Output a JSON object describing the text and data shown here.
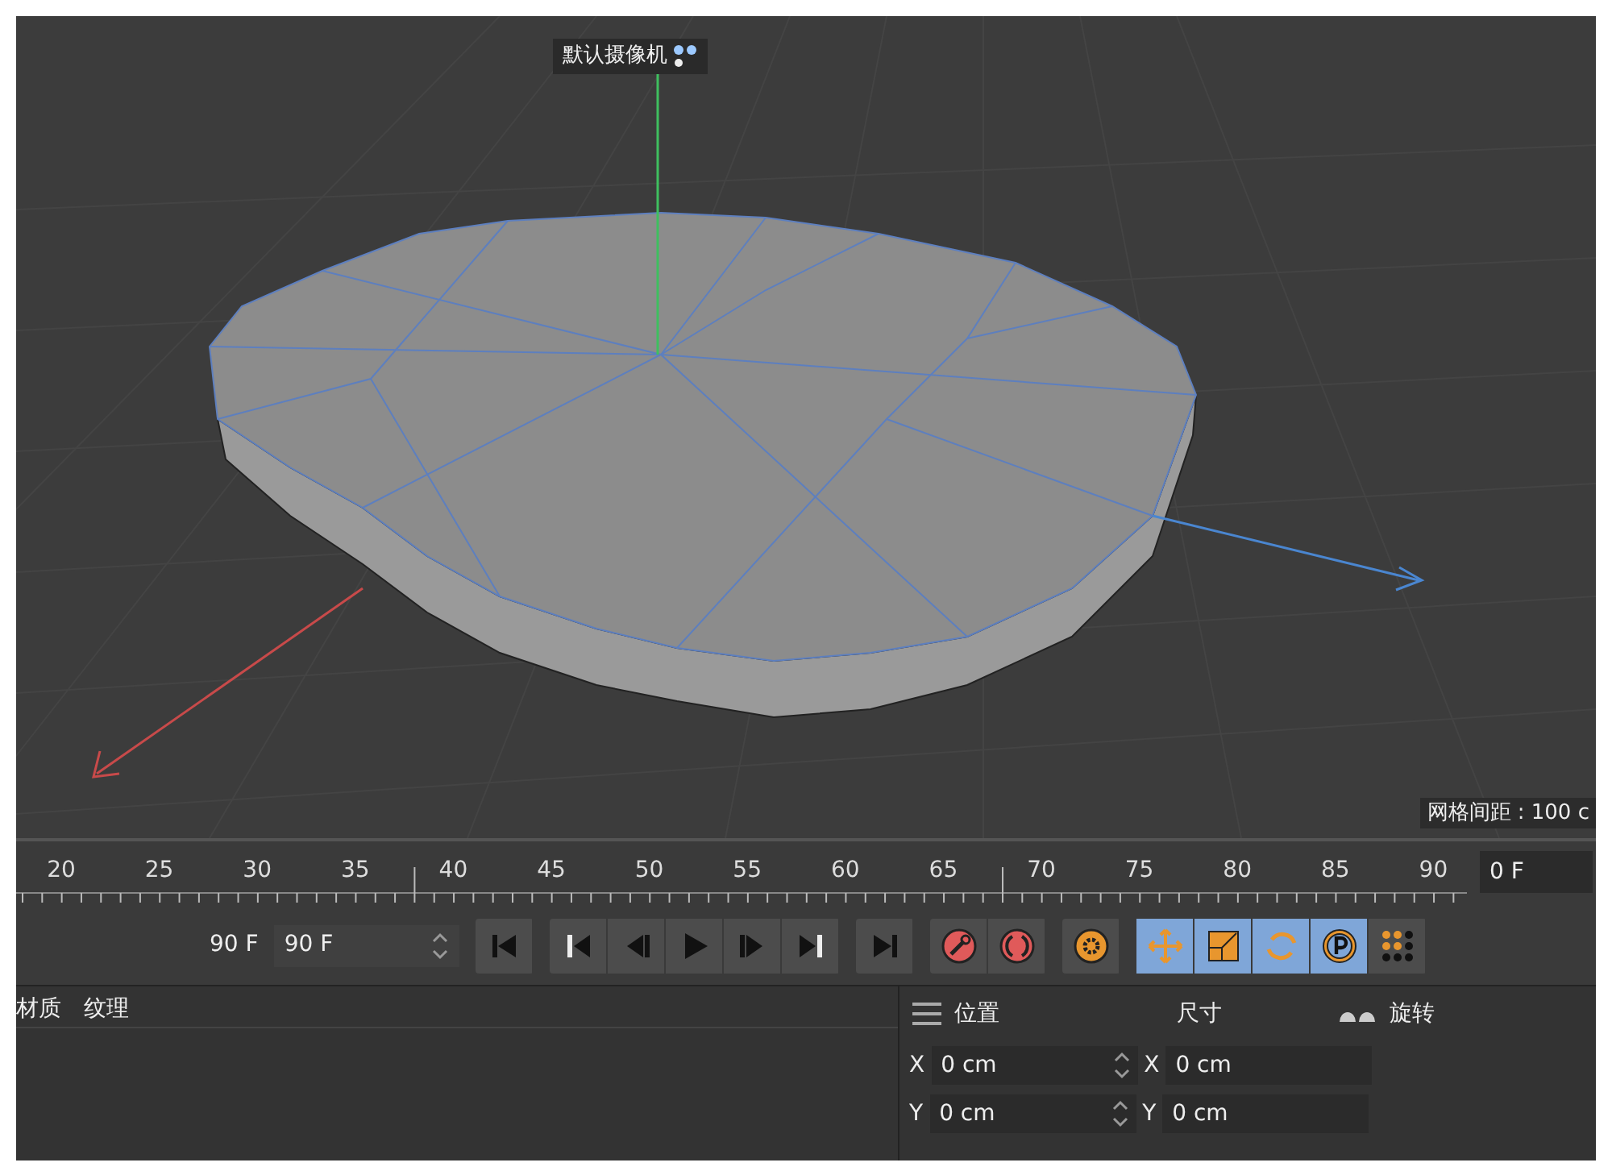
{
  "viewport": {
    "camera_label": "默认摄像机",
    "grid_spacing": "网格间距 : 100 c"
  },
  "timeline": {
    "ticks": [
      "20",
      "25",
      "30",
      "35",
      "40",
      "45",
      "50",
      "55",
      "60",
      "65",
      "70",
      "75",
      "80",
      "85",
      "90"
    ],
    "current_frame": "0 F"
  },
  "toolbar": {
    "min_frame": "90 F",
    "max_frame": "90 F",
    "transport": [
      {
        "kind": "first"
      },
      {
        "kind": "prev-key"
      },
      {
        "kind": "prev-frame"
      },
      {
        "kind": "play"
      },
      {
        "kind": "next-frame"
      },
      {
        "kind": "next-key"
      },
      {
        "kind": "last"
      }
    ],
    "tools": [
      {
        "kind": "record",
        "selected": false
      },
      {
        "kind": "autokey",
        "selected": false
      },
      {
        "kind": "gear",
        "selected": false
      },
      {
        "kind": "move",
        "selected": true
      },
      {
        "kind": "scale",
        "selected": true
      },
      {
        "kind": "rotate",
        "selected": true
      },
      {
        "kind": "param",
        "selected": true
      },
      {
        "kind": "dots",
        "selected": false
      }
    ]
  },
  "material_tabs": [
    {
      "label": "材质"
    },
    {
      "label": "纹理"
    }
  ],
  "coordinates": {
    "headers": [
      "位置",
      "尺寸",
      "旋转"
    ],
    "rows": [
      {
        "axis": "X",
        "position": "0 cm",
        "size_axis": "X",
        "size": "0 cm"
      },
      {
        "axis": "Y",
        "position": "0 cm",
        "size_axis": "Y",
        "size": "0 cm"
      }
    ]
  }
}
